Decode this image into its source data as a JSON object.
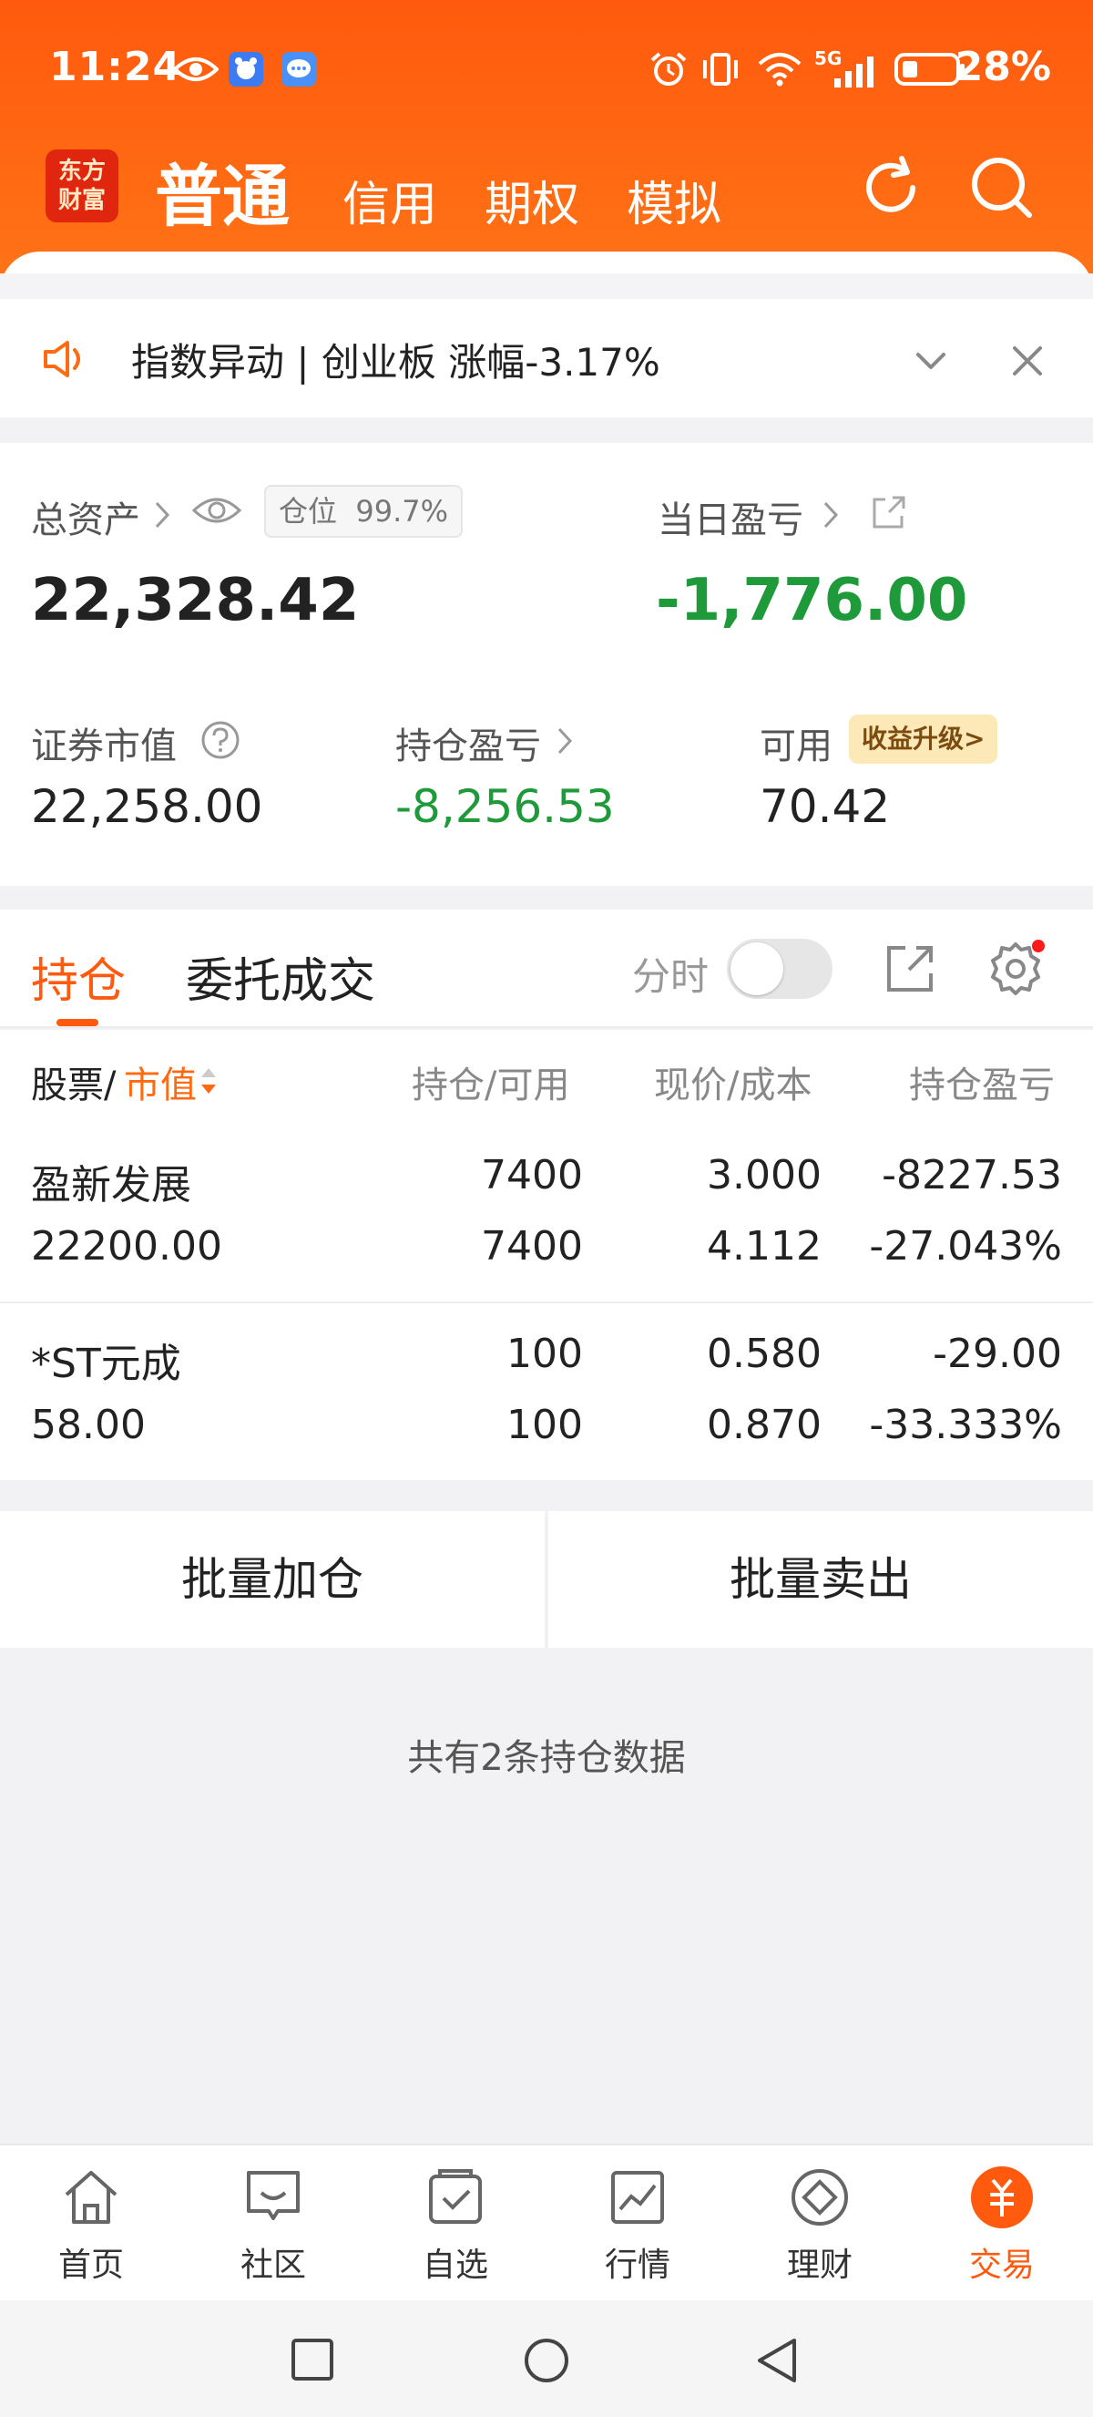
{
  "status_bar": {
    "time": "11:24",
    "network": "5G",
    "battery": "28%"
  },
  "nav": {
    "logo_line1": "东方",
    "logo_line2": "财富",
    "tabs": [
      "普通",
      "信用",
      "期权",
      "模拟"
    ]
  },
  "notice": {
    "text": "指数异动 | 创业板 涨幅-3.17%"
  },
  "account": {
    "total_assets_label": "总资产",
    "position_label": "仓位",
    "position_value": "99.7%",
    "total_assets": "22,328.42",
    "daily_pnl_label": "当日盈亏",
    "daily_pnl": "-1,776.00",
    "market_value_label": "证券市值",
    "market_value": "22,258.00",
    "holding_pnl_label": "持仓盈亏",
    "holding_pnl": "-8,256.53",
    "available_label": "可用",
    "upgrade_badge": "收益升级>",
    "available": "70.42"
  },
  "tabs": {
    "holdings": "持仓",
    "orders": "委托成交",
    "timeshare": "分时"
  },
  "table": {
    "headers": {
      "stock": "股票/",
      "market_value": "市值",
      "position": "持仓/可用",
      "price": "现价/成本",
      "pnl": "持仓盈亏"
    },
    "rows": [
      {
        "name": "盈新发展",
        "market_value": "22200.00",
        "position": "7400",
        "available": "7400",
        "price": "3.000",
        "cost": "4.112",
        "pnl": "-8227.53",
        "pnl_pct": "-27.043%"
      },
      {
        "name": "*ST元成",
        "market_value": "58.00",
        "position": "100",
        "available": "100",
        "price": "0.580",
        "cost": "0.870",
        "pnl": "-29.00",
        "pnl_pct": "-33.333%"
      }
    ]
  },
  "actions": {
    "batch_add": "批量加仓",
    "batch_sell": "批量卖出"
  },
  "footer_note": "共有2条持仓数据",
  "bottom_nav": [
    {
      "label": "首页",
      "icon": "home-icon"
    },
    {
      "label": "社区",
      "icon": "community-icon"
    },
    {
      "label": "自选",
      "icon": "watchlist-icon"
    },
    {
      "label": "行情",
      "icon": "market-icon"
    },
    {
      "label": "理财",
      "icon": "wealth-icon"
    },
    {
      "label": "交易",
      "icon": "trade-icon"
    }
  ],
  "colors": {
    "brand": "#ff5a0e",
    "loss": "#1f9a3a",
    "accent_text": "#ff6a12"
  }
}
